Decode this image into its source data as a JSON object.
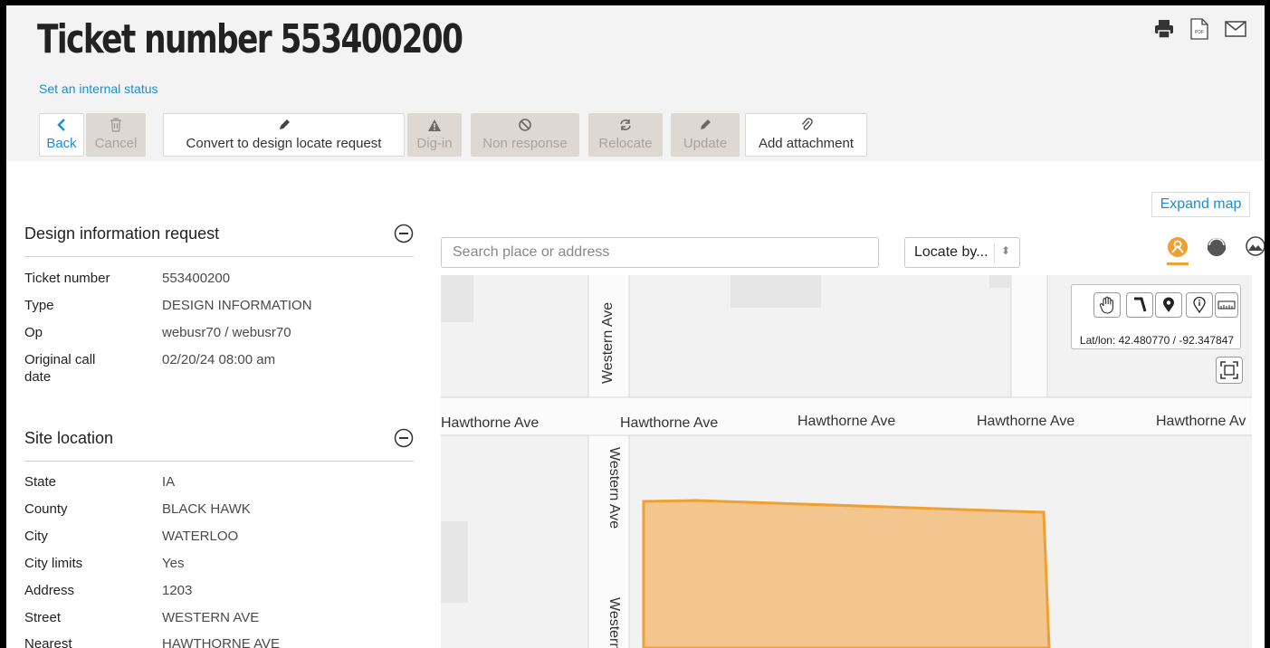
{
  "header": {
    "title": "Ticket number 553400200",
    "internal_status_link": "Set an internal status",
    "icons": [
      "printer-icon",
      "pdf-icon",
      "mail-icon"
    ],
    "pdf_label": "PDF"
  },
  "toolbar": {
    "buttons": [
      {
        "label": "Back",
        "icon": "chevron-left-icon",
        "enabled": true
      },
      {
        "label": "Cancel",
        "icon": "trash-icon",
        "enabled": false
      },
      {
        "label": "Convert to design locate request",
        "icon": "pencil-icon",
        "enabled": true
      },
      {
        "label": "Dig-in",
        "icon": "warning-icon",
        "enabled": false
      },
      {
        "label": "Non response",
        "icon": "prohibited-icon",
        "enabled": false
      },
      {
        "label": "Relocate",
        "icon": "refresh-icon",
        "enabled": false
      },
      {
        "label": "Update",
        "icon": "pencil-icon",
        "enabled": false
      },
      {
        "label": "Add attachment",
        "icon": "paperclip-icon",
        "enabled": true
      }
    ]
  },
  "design_info": {
    "title": "Design information request",
    "fields": [
      {
        "label": "Ticket number",
        "value": "553400200"
      },
      {
        "label": "Type",
        "value": "DESIGN INFORMATION"
      },
      {
        "label": "Op",
        "value": "webusr70 / webusr70"
      },
      {
        "label": "Original call date",
        "value": "02/20/24 08:00 am"
      }
    ]
  },
  "site_location": {
    "title": "Site location",
    "fields": [
      {
        "label": "State",
        "value": "IA"
      },
      {
        "label": "County",
        "value": "BLACK HAWK"
      },
      {
        "label": "City",
        "value": "WATERLOO"
      },
      {
        "label": "City limits",
        "value": "Yes"
      },
      {
        "label": "Address",
        "value": "1203"
      },
      {
        "label": "Street",
        "value": "WESTERN AVE"
      },
      {
        "label": "Nearest",
        "value": "HAWTHORNE AVE"
      }
    ]
  },
  "map": {
    "expand_label": "Expand map",
    "search_placeholder": "Search place or address",
    "locate_label": "Locate by...",
    "layer_icons": [
      "locator-layer-icon",
      "support-layer-icon",
      "terrain-layer-icon"
    ],
    "street_labels": {
      "horizontal": [
        "Hawthorne Ave",
        "Hawthorne Ave",
        "Hawthorne Ave",
        "Hawthorne Ave",
        "Hawthorne Av"
      ],
      "vertical": [
        "Western Ave",
        "Western Ave",
        "Western"
      ]
    },
    "tools": [
      "pan-hand-icon",
      "draw-line-icon",
      "map-pin-icon",
      "info-pin-icon",
      "measure-ruler-icon"
    ],
    "latlon_text": "Lat/lon: 42.480770 / -92.347847",
    "fullscreen_icon": "fullscreen-icon",
    "accent_color": "#f0a030",
    "polygon_fill": "#f2c68e"
  }
}
